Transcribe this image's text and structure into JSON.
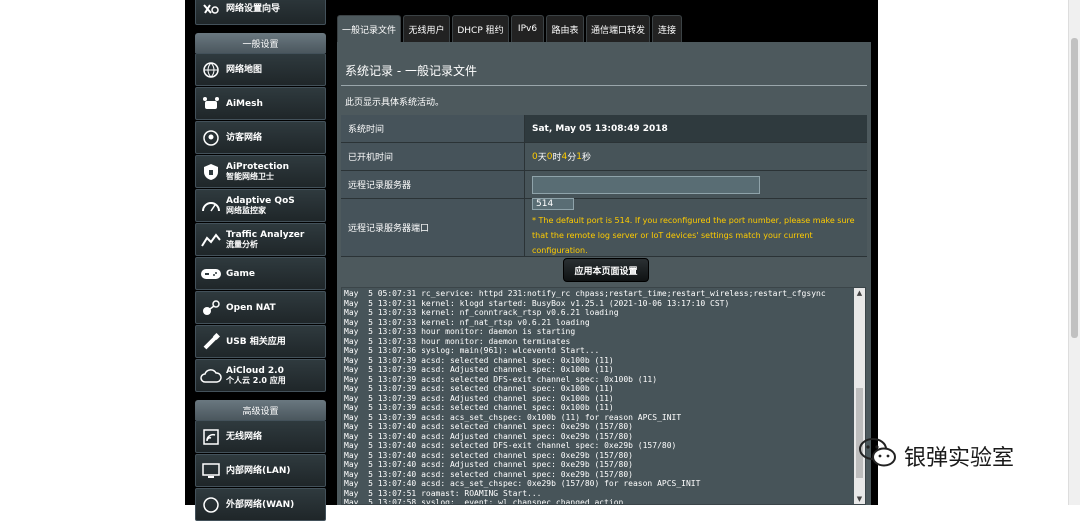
{
  "sidebar": {
    "top_item": "网络设置向导",
    "general_header": "一般设置",
    "general_items": [
      {
        "label": "网络地图",
        "sub": ""
      },
      {
        "label": "AiMesh",
        "sub": ""
      },
      {
        "label": "访客网络",
        "sub": ""
      },
      {
        "label": "AiProtection",
        "sub": "智能网络卫士"
      },
      {
        "label": "Adaptive QoS",
        "sub": "网络监控家"
      },
      {
        "label": "Traffic Analyzer",
        "sub": "流量分析"
      },
      {
        "label": "Game",
        "sub": ""
      },
      {
        "label": "Open NAT",
        "sub": ""
      },
      {
        "label": "USB 相关应用",
        "sub": ""
      },
      {
        "label": "AiCloud 2.0",
        "sub": "个人云 2.0 应用"
      }
    ],
    "advanced_header": "高级设置",
    "advanced_items": [
      {
        "label": "无线网络"
      },
      {
        "label": "内部网络(LAN)"
      },
      {
        "label": "外部网络(WAN)"
      }
    ]
  },
  "tabs": [
    "一般记录文件",
    "无线用户",
    "DHCP 租约",
    "IPv6",
    "路由表",
    "通信端口转发",
    "连接"
  ],
  "content": {
    "title_prefix": "系统记录",
    "title_sep": " - ",
    "title_suffix": "一般记录文件",
    "description": "此页显示具体系统活动。",
    "rows": {
      "system_time_label": "系统时间",
      "system_time_value": "Sat, May 05 13:08:49 2018",
      "uptime_label": "已开机时间",
      "uptime_days": "0",
      "uptime_days_unit": " 天 ",
      "uptime_hours": "0",
      "uptime_hours_unit": " 时 ",
      "uptime_mins": "4",
      "uptime_mins_unit": " 分 ",
      "uptime_secs": "1",
      "uptime_secs_unit": " 秒",
      "remote_server_label": "远程记录服务器",
      "remote_server_value": "",
      "remote_port_label": "远程记录服务器端口",
      "remote_port_value": "514",
      "remote_port_note": "* The default port is 514. If you reconfigured the port number, please make sure that the remote log server or IoT devices' settings match your current configuration."
    },
    "apply_button": "应用本页面设置"
  },
  "log_lines": [
    "May  5 05:07:31 rc_service: httpd 231:notify_rc chpass;restart_time;restart_wireless;restart_cfgsync",
    "May  5 13:07:31 kernel: klogd started: BusyBox v1.25.1 (2021-10-06 13:17:10 CST)",
    "May  5 13:07:33 kernel: nf_conntrack_rtsp v0.6.21 loading",
    "May  5 13:07:33 kernel: nf_nat_rtsp v0.6.21 loading",
    "May  5 13:07:33 hour monitor: daemon is starting",
    "May  5 13:07:33 hour monitor: daemon terminates",
    "May  5 13:07:36 syslog: main(961): wlceventd Start...",
    "May  5 13:07:39 acsd: selected channel spec: 0x100b (11)",
    "May  5 13:07:39 acsd: Adjusted channel spec: 0x100b (11)",
    "May  5 13:07:39 acsd: selected DFS-exit channel spec: 0x100b (11)",
    "May  5 13:07:39 acsd: selected channel spec: 0x100b (11)",
    "May  5 13:07:39 acsd: Adjusted channel spec: 0x100b (11)",
    "May  5 13:07:39 acsd: selected channel spec: 0x100b (11)",
    "May  5 13:07:39 acsd: acs_set_chspec: 0x100b (11) for reason APCS_INIT",
    "May  5 13:07:40 acsd: selected channel spec: 0xe29b (157/80)",
    "May  5 13:07:40 acsd: Adjusted channel spec: 0xe29b (157/80)",
    "May  5 13:07:40 acsd: selected DFS-exit channel spec: 0xe29b (157/80)",
    "May  5 13:07:40 acsd: selected channel spec: 0xe29b (157/80)",
    "May  5 13:07:40 acsd: Adjusted channel spec: 0xe29b (157/80)",
    "May  5 13:07:40 acsd: selected channel spec: 0xe29b (157/80)",
    "May  5 13:07:40 acsd: acs_set_chspec: 0xe29b (157/80) for reason APCS_INIT",
    "May  5 13:07:51 roamast: ROAMING Start...",
    "May  5 13:07:58 syslog:  event: wl chanspec changed action"
  ],
  "watermark": "银弹实验室",
  "colors": {
    "accent": "#ffcc00",
    "panel": "#4d595d",
    "background": "#000000"
  }
}
